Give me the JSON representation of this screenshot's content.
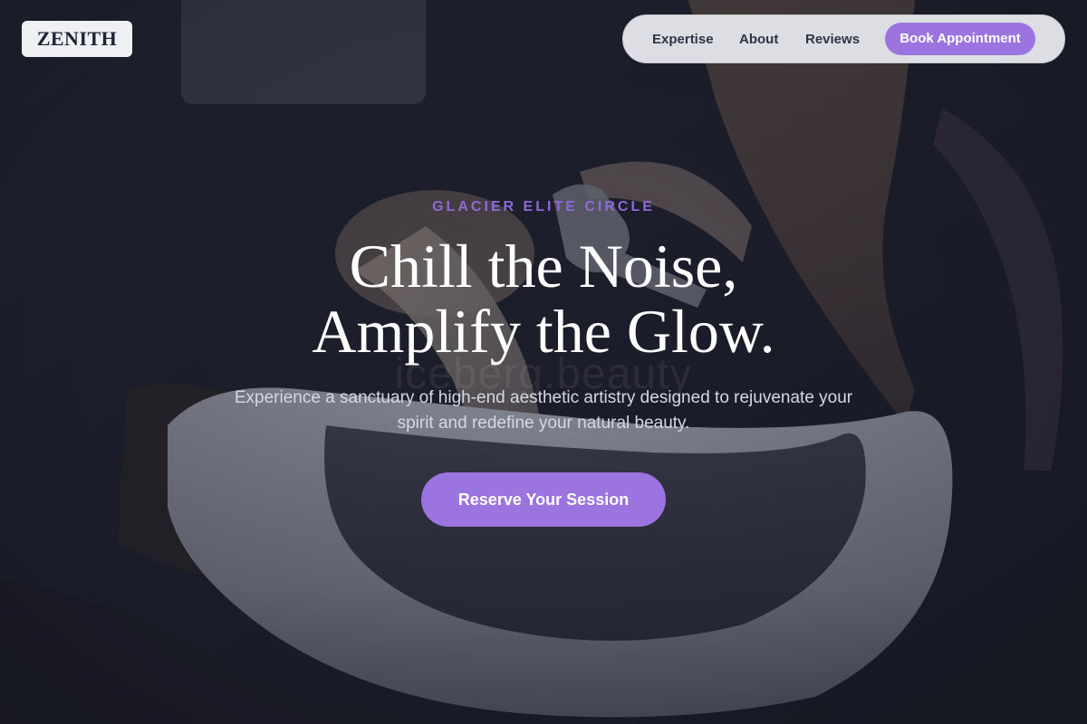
{
  "brand": {
    "logo_text": "ZENITH"
  },
  "nav": {
    "links": [
      {
        "label": "Expertise"
      },
      {
        "label": "About"
      },
      {
        "label": "Reviews"
      }
    ],
    "cta_label": "Book Appointment"
  },
  "hero": {
    "eyebrow": "GLACIER ELITE CIRCLE",
    "headline_line1": "Chill the Noise,",
    "headline_line2": "Amplify the Glow.",
    "subtitle": "Experience a sanctuary of high-end aesthetic artistry designed to rejuvenate your spirit and redefine your natural beauty.",
    "cta_label": "Reserve Your Session",
    "watermark": "iceberg.beauty",
    "image_subject": "salon-hair-wash-photo"
  },
  "colors": {
    "accent": "#9b74e0",
    "eyebrow": "#8e6ad6",
    "nav_bg": "#dcdee3",
    "logo_bg": "#eef0f3",
    "background": "#1a1c28"
  }
}
